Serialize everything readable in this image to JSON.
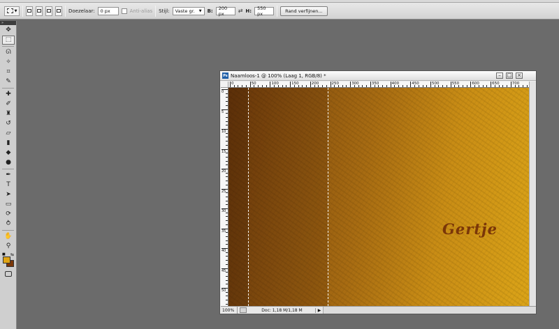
{
  "options": {
    "doezelaar_label": "Doezelaar:",
    "doezelaar_value": "0 px",
    "antialias_label": "Anti-alias",
    "stijl_label": "Stijl:",
    "stijl_value": "Vaste gr.",
    "b_label": "B:",
    "b_value": "200 px",
    "h_label": "H:",
    "h_value": "550 px",
    "refine_label": "Rand verfijnen..."
  },
  "toolbox": {
    "grip": "»",
    "tools": [
      {
        "name": "move-tool",
        "glyph": "✥"
      },
      {
        "name": "rect-marquee-tool",
        "glyph": "⬚",
        "active": true
      },
      {
        "name": "lasso-tool",
        "glyph": "ᘏ"
      },
      {
        "name": "magic-wand-tool",
        "glyph": "✧"
      },
      {
        "name": "crop-tool",
        "glyph": "⌗"
      },
      {
        "name": "eyedropper-tool",
        "glyph": "✎"
      },
      {
        "name": "healing-brush-tool",
        "glyph": "✚"
      },
      {
        "name": "brush-tool",
        "glyph": "✐"
      },
      {
        "name": "clone-stamp-tool",
        "glyph": "♜"
      },
      {
        "name": "history-brush-tool",
        "glyph": "↺"
      },
      {
        "name": "eraser-tool",
        "glyph": "▱"
      },
      {
        "name": "gradient-tool",
        "glyph": "▮"
      },
      {
        "name": "blur-tool",
        "glyph": "◆"
      },
      {
        "name": "dodge-tool",
        "glyph": "●"
      },
      {
        "name": "pen-tool",
        "glyph": "✒"
      },
      {
        "name": "type-tool",
        "glyph": "T"
      },
      {
        "name": "path-selection-tool",
        "glyph": "➤"
      },
      {
        "name": "shape-tool",
        "glyph": "▭"
      },
      {
        "name": "3d-rotate-tool",
        "glyph": "⟳"
      },
      {
        "name": "3d-orbit-tool",
        "glyph": "⥁"
      },
      {
        "name": "hand-tool",
        "glyph": "✋"
      },
      {
        "name": "zoom-tool",
        "glyph": "⚲"
      }
    ],
    "colors": {
      "foreground": "#e0a414",
      "background": "#7a3608"
    }
  },
  "document": {
    "title": "Naamloos-1 @ 100% (Laag 1, RGB/8) *",
    "ps_icon": "Ps",
    "zoom": "100%",
    "doc_size": "Doc: 1,18 M/1,18 M",
    "canvas_text": "Gertje",
    "ruler_top_labels": [
      "0",
      "50",
      "100",
      "150",
      "200",
      "250",
      "300",
      "350",
      "400",
      "450",
      "500",
      "550",
      "600",
      "650",
      "700"
    ],
    "ruler_left_labels": [
      "0",
      "5",
      "10",
      "15",
      "20",
      "25",
      "30",
      "35",
      "40",
      "45",
      "50"
    ]
  }
}
